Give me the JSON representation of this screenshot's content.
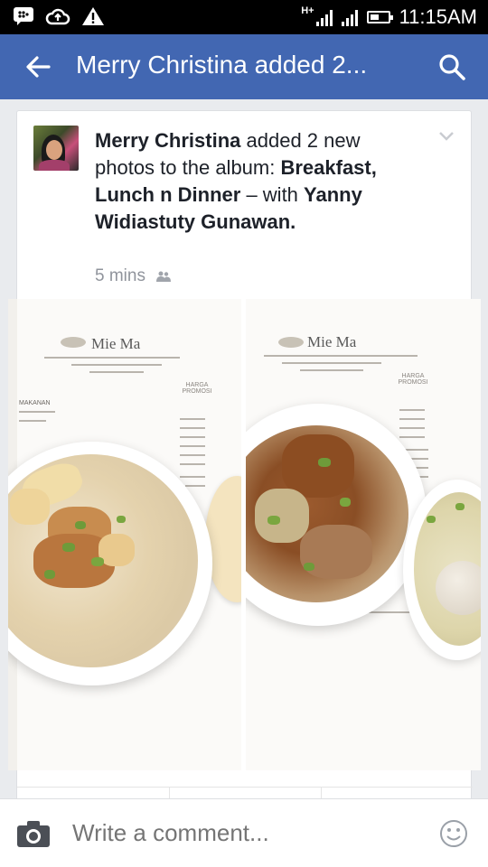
{
  "status_bar": {
    "time": "11:15AM",
    "network_label": "H+",
    "icons": [
      "bbm-icon",
      "cloud-upload-icon",
      "warning-icon",
      "signal-icon",
      "signal-icon",
      "battery-icon"
    ]
  },
  "app_bar": {
    "title": "Merry Christina added 2...",
    "back_icon": "arrow-left-icon",
    "search_icon": "search-icon",
    "color": "#4267b2"
  },
  "post": {
    "author": "Merry Christina",
    "action_text": " added 2 new photos to the album: ",
    "album": "Breakfast, Lunch n Dinner",
    "with_prefix": " – with ",
    "tagged": "Yanny Widiastuty Gunawan",
    "suffix": ".",
    "time": "5 mins",
    "audience_icon": "friends-icon"
  },
  "photos": [
    {
      "menu_title": "Mie Ma",
      "menu_heading": "MAKANAN",
      "promo_label": "HARGA PROMOSI"
    },
    {
      "menu_title": "Mie Ma",
      "promo_label": "HARGA PROMOSI"
    }
  ],
  "comment_bar": {
    "placeholder": "Write a comment...",
    "camera_icon": "camera-icon",
    "emoji_icon": "smiley-icon"
  }
}
